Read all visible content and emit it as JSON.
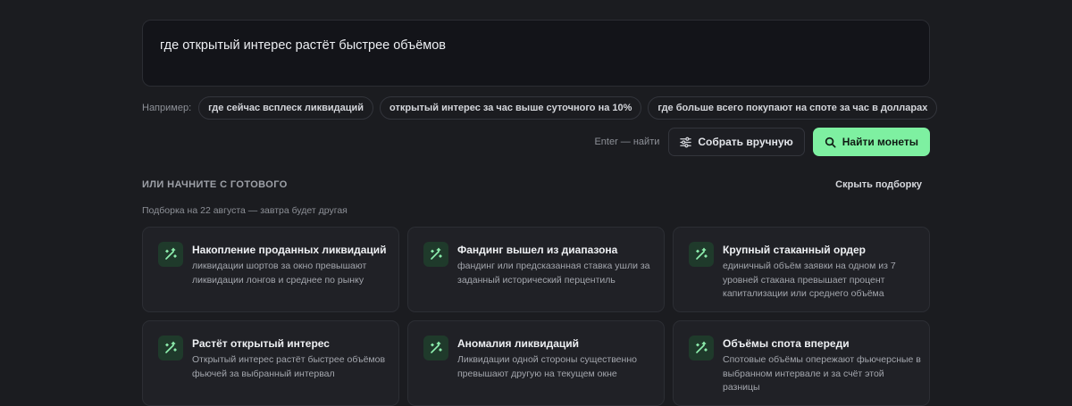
{
  "query": {
    "text": "где открытый интерес растёт быстрее объёмов"
  },
  "examples": {
    "label": "Например:",
    "chips": [
      "где сейчас всплеск ликвидаций",
      "открытый интерес за час выше суточного на 10%",
      "где больше всего покупают на споте за час в долларах"
    ]
  },
  "actions": {
    "hint": "Enter — найти",
    "manual_label": "Собрать вручную",
    "find_label": "Найти монеты",
    "accent": "#7ef0a1"
  },
  "presets": {
    "title": "ИЛИ НАЧНИТЕ С ГОТОВОГО",
    "hide_label": "Скрыть подборку",
    "subtitle": "Подборка на 22 августа — завтра будет другая",
    "cards": [
      {
        "title": "Накопление проданных ликвидаций",
        "desc": "ликвидации шортов за окно превышают ликвидации лонгов и среднее по рынку",
        "icon": "magic-wand-icon"
      },
      {
        "title": "Фандинг вышел из диапазона",
        "desc": "фандинг или предсказанная ставка ушли за заданный исторический перцентиль",
        "icon": "magic-wand-icon"
      },
      {
        "title": "Крупный стаканный ордер",
        "desc": "единичный объём заявки на одном из 7 уровней стакана превышает процент капитализации или среднего объёма",
        "icon": "magic-wand-icon"
      },
      {
        "title": "Растёт открытый интерес",
        "desc": "Открытый интерес растёт быстрее объёмов фьючей за выбранный интервал",
        "icon": "magic-wand-icon"
      },
      {
        "title": "Аномалия ликвидаций",
        "desc": "Ликвидации одной стороны существенно превышают другую на текущем окне",
        "icon": "magic-wand-icon"
      },
      {
        "title": "Объёмы спота впереди",
        "desc": "Спотовые объёмы опережают фьючерсные в выбранном интервале и за счёт этой разницы",
        "icon": "magic-wand-icon"
      }
    ]
  }
}
